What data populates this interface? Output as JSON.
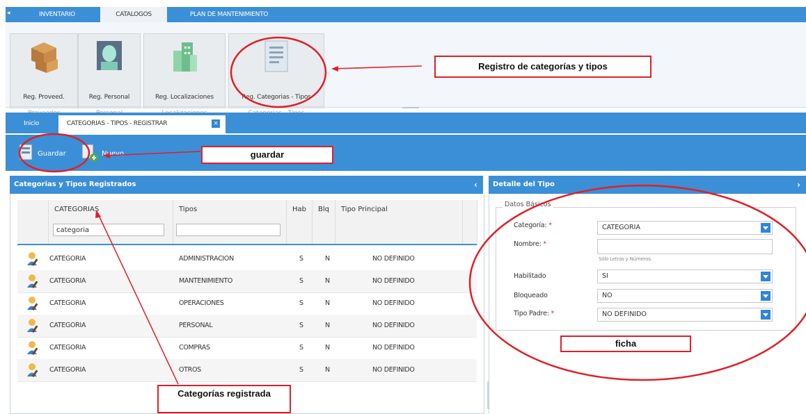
{
  "top_menu": {
    "tabs": [
      "INVENTARIO",
      "CATALOGOS",
      "PLAN DE MANTENIMIENTO"
    ],
    "active": "CATALOGOS"
  },
  "ribbon": {
    "buttons": [
      {
        "label": "Reg. Proveed.",
        "group": "Proveedor",
        "icon": "boxes-icon"
      },
      {
        "label": "Reg. Personal",
        "group": "Personal",
        "icon": "person-icon"
      },
      {
        "label": "Reg. Localizaciones",
        "group": "Localizaciones",
        "icon": "buildings-icon"
      },
      {
        "label": "Reg. Categorias - Tipos",
        "group": "Categorias - Tipos",
        "icon": "document-icon"
      }
    ]
  },
  "doc_tabs": {
    "home": "Inicio",
    "active": "CATEGORIAS - TIPOS - REGISTRAR"
  },
  "toolbar": {
    "save": "Guardar",
    "new": "Nuevo"
  },
  "left_panel": {
    "title": "Categorias y Tipos Registrados",
    "columns": [
      "CATEGORIAS",
      "Tipos",
      "Hab",
      "Blq",
      "Tipo Principal"
    ],
    "filter_value": "categoria",
    "rows": [
      {
        "categoria": "CATEGORIA",
        "tipo": "ADMINISTRACION",
        "hab": "S",
        "blq": "N",
        "principal": "NO DEFINIDO"
      },
      {
        "categoria": "CATEGORIA",
        "tipo": "MANTENIMIENTO",
        "hab": "S",
        "blq": "N",
        "principal": "NO DEFINIDO"
      },
      {
        "categoria": "CATEGORIA",
        "tipo": "OPERACIONES",
        "hab": "S",
        "blq": "N",
        "principal": "NO DEFINIDO"
      },
      {
        "categoria": "CATEGORIA",
        "tipo": "PERSONAL",
        "hab": "S",
        "blq": "N",
        "principal": "NO DEFINIDO"
      },
      {
        "categoria": "CATEGORIA",
        "tipo": "COMPRAS",
        "hab": "S",
        "blq": "N",
        "principal": "NO DEFINIDO"
      },
      {
        "categoria": "CATEGORIA",
        "tipo": "OTROS",
        "hab": "S",
        "blq": "N",
        "principal": "NO DEFINIDO"
      }
    ]
  },
  "right_panel": {
    "title": "Detalle del Tipo",
    "legend": "Datos Básicos",
    "fields": {
      "categoria": {
        "label": "Categoría:",
        "value": "CATEGORIA"
      },
      "nombre": {
        "label": "Nombre:",
        "value": "",
        "hint": "Sólo Letras y Números."
      },
      "habilitado": {
        "label": "Habilitado",
        "value": "SI"
      },
      "bloqueado": {
        "label": "Bloqueado",
        "value": "NO"
      },
      "tipo_padre": {
        "label": "Tipo Padre:",
        "value": "NO DEFINIDO"
      }
    },
    "required_mark": "*"
  },
  "annotations": {
    "registro": "Registro de categorías y tipos",
    "guardar": "guardar",
    "ficha": "ficha",
    "categorias": "Categorías registrada"
  },
  "colors": {
    "header_blue": "#3b8fd6",
    "annotation_red": "#e21e26",
    "dropdown_blue": "#2e86d8"
  }
}
